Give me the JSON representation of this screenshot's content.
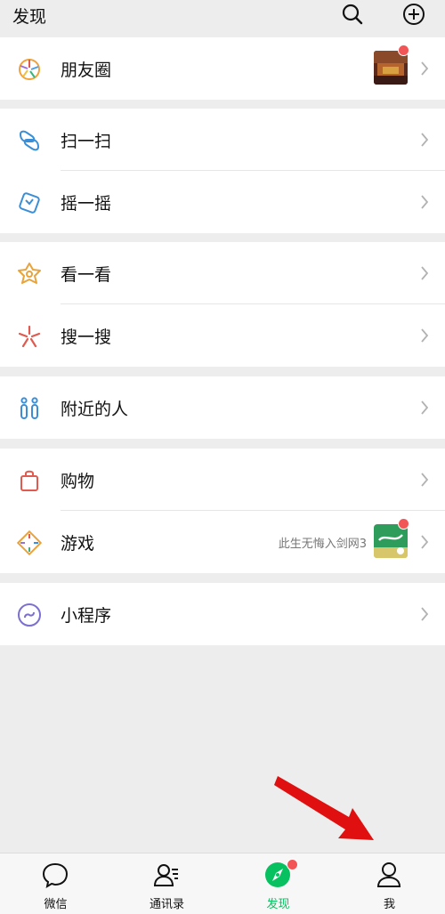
{
  "header": {
    "title": "发现"
  },
  "groups": [
    {
      "items": [
        {
          "label": "朋友圈"
        }
      ]
    },
    {
      "items": [
        {
          "label": "扫一扫"
        },
        {
          "label": "摇一摇"
        }
      ]
    },
    {
      "items": [
        {
          "label": "看一看"
        },
        {
          "label": "搜一搜"
        }
      ]
    },
    {
      "items": [
        {
          "label": "附近的人"
        }
      ]
    },
    {
      "items": [
        {
          "label": "购物"
        },
        {
          "label": "游戏",
          "subtitle": "此生无悔入剑网3"
        }
      ]
    },
    {
      "items": [
        {
          "label": "小程序"
        }
      ]
    }
  ],
  "tabbar": {
    "tabs": [
      {
        "label": "微信"
      },
      {
        "label": "通讯录"
      },
      {
        "label": "发现"
      },
      {
        "label": "我"
      }
    ],
    "active": "发现"
  },
  "colors": {
    "accent": "#07c160",
    "badge": "#f25555",
    "background": "#ededed"
  }
}
